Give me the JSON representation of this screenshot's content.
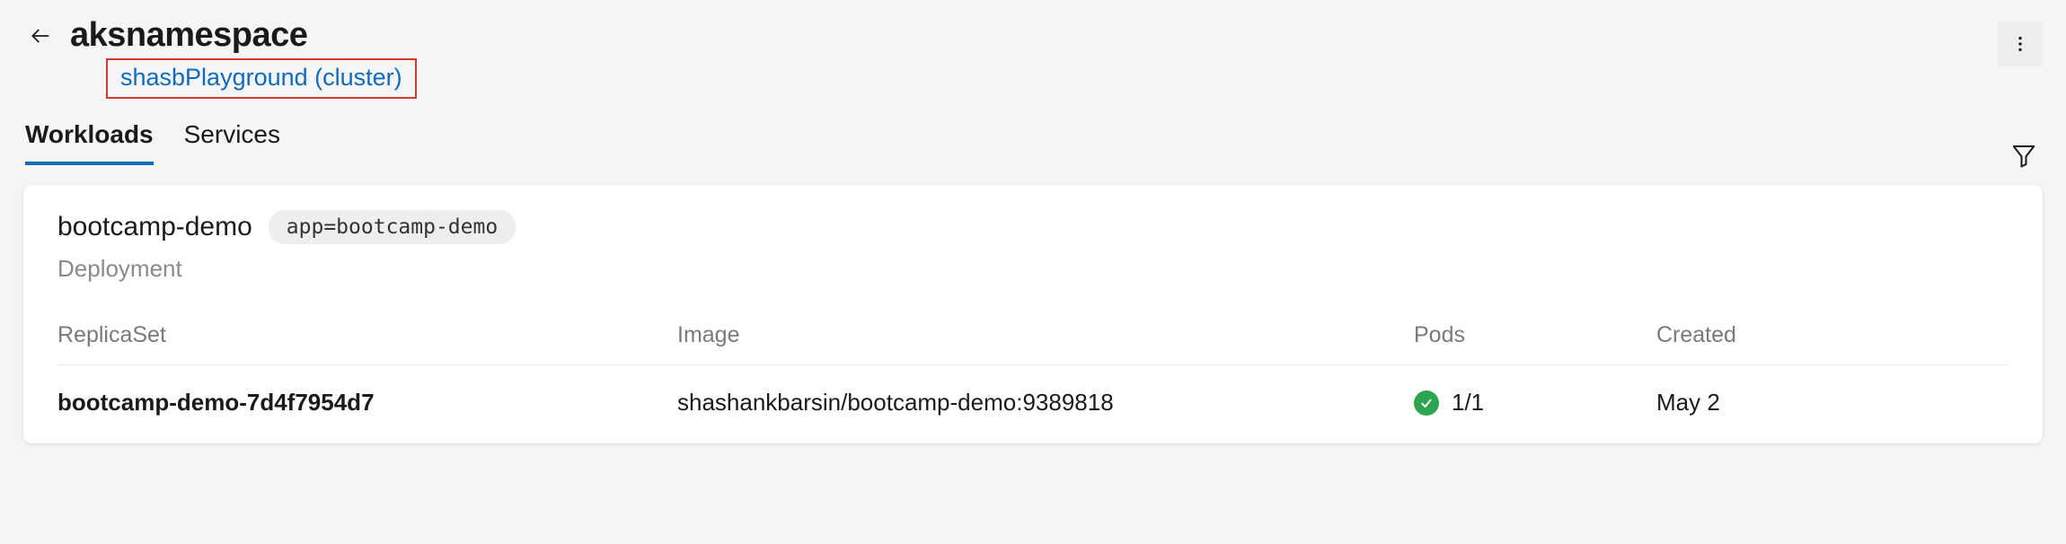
{
  "header": {
    "title": "aksnamespace",
    "cluster_link": "shasbPlayground (cluster)"
  },
  "tabs": {
    "items": [
      {
        "label": "Workloads",
        "active": true
      },
      {
        "label": "Services",
        "active": false
      }
    ]
  },
  "workload": {
    "name": "bootcamp-demo",
    "tag": "app=bootcamp-demo",
    "kind": "Deployment"
  },
  "columns": {
    "replicaset": "ReplicaSet",
    "image": "Image",
    "pods": "Pods",
    "created": "Created"
  },
  "rows": [
    {
      "replicaset": "bootcamp-demo-7d4f7954d7",
      "image": "shashankbarsin/bootcamp-demo:9389818",
      "pods": "1/1",
      "created": "May 2",
      "status": "ok"
    }
  ]
}
